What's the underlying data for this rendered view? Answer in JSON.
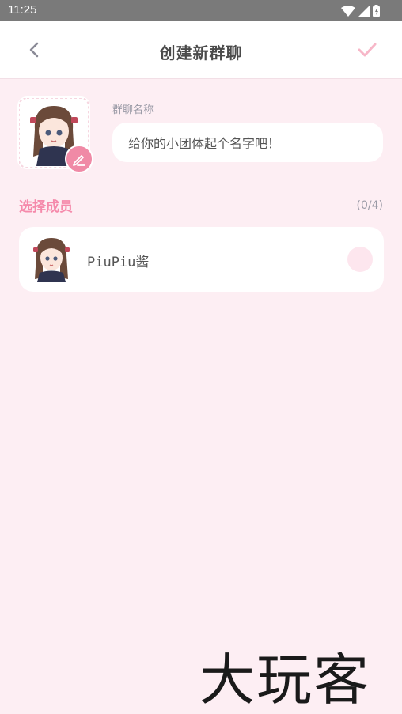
{
  "status_bar": {
    "time": "11:25",
    "icons": [
      "wifi-icon",
      "signal-icon",
      "battery-icon"
    ]
  },
  "header": {
    "title": "创建新群聊",
    "back_icon": "chevron-left-icon",
    "confirm_icon": "check-icon"
  },
  "group_name": {
    "label": "群聊名称",
    "placeholder": "给你的小团体起个名字吧！"
  },
  "members_section": {
    "title": "选择成员",
    "count": "(0/4)",
    "members": [
      {
        "name": "PiuPiu酱",
        "selected": false
      }
    ]
  },
  "watermark": {
    "text": "大玩客"
  },
  "colors": {
    "accent": "#f58aab",
    "background": "#fdeef3",
    "card": "#ffffff",
    "confirm": "#f7b7c8"
  }
}
